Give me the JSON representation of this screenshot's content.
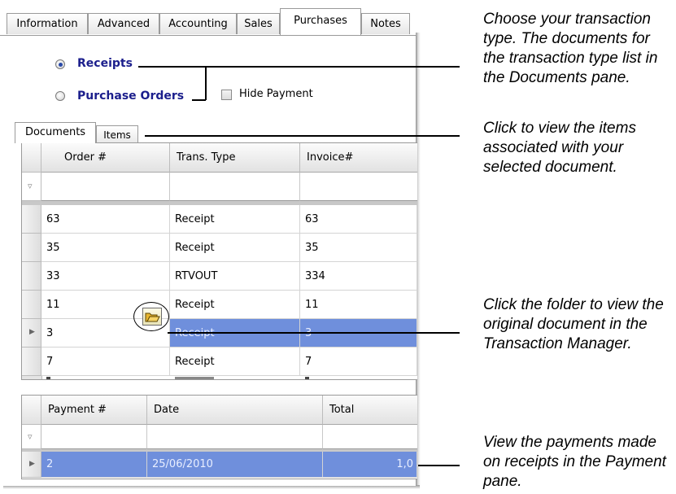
{
  "tabs": [
    {
      "label": "Information"
    },
    {
      "label": "Advanced"
    },
    {
      "label": "Accounting"
    },
    {
      "label": "Sales"
    },
    {
      "label": "Purchases"
    },
    {
      "label": "Notes"
    }
  ],
  "transaction_type": {
    "receipts_label": "Receipts",
    "purchase_orders_label": "Purchase Orders",
    "selected": "Receipts",
    "hide_payment_label": "Hide Payment",
    "hide_payment_checked": false
  },
  "subtabs": [
    {
      "label": "Documents"
    },
    {
      "label": "Items"
    }
  ],
  "documents": {
    "columns": [
      "Order #",
      "Trans. Type",
      "Invoice#"
    ],
    "rows": [
      {
        "order": "63",
        "type": "Receipt",
        "invoice": "63"
      },
      {
        "order": "35",
        "type": "Receipt",
        "invoice": "35"
      },
      {
        "order": "33",
        "type": "RTVOUT",
        "invoice": "334"
      },
      {
        "order": "11",
        "type": "Receipt",
        "invoice": "11"
      },
      {
        "order": "3",
        "type": "Receipt",
        "invoice": "3"
      },
      {
        "order": "7",
        "type": "Receipt",
        "invoice": "7"
      }
    ],
    "selected_row": 4
  },
  "payments": {
    "columns": [
      "Payment #",
      "Date",
      "Total"
    ],
    "rows": [
      {
        "payment": "2",
        "date": "25/06/2010",
        "total": "1,0"
      }
    ]
  },
  "captions": {
    "transaction_type": [
      "Choose your transaction",
      "type. The documents for",
      "the transaction type list in",
      "the Documents pane."
    ],
    "items": [
      "Click to view the items",
      "associated with your",
      "selected document."
    ],
    "folder": [
      "Click the folder to view the",
      "original document in the",
      "Transaction Manager."
    ],
    "payments": [
      "View the payments made",
      "on receipts in the Payment",
      "pane."
    ]
  },
  "colors": {
    "selection": "#6f8fdc",
    "radio_label": "#1b1e8c"
  }
}
